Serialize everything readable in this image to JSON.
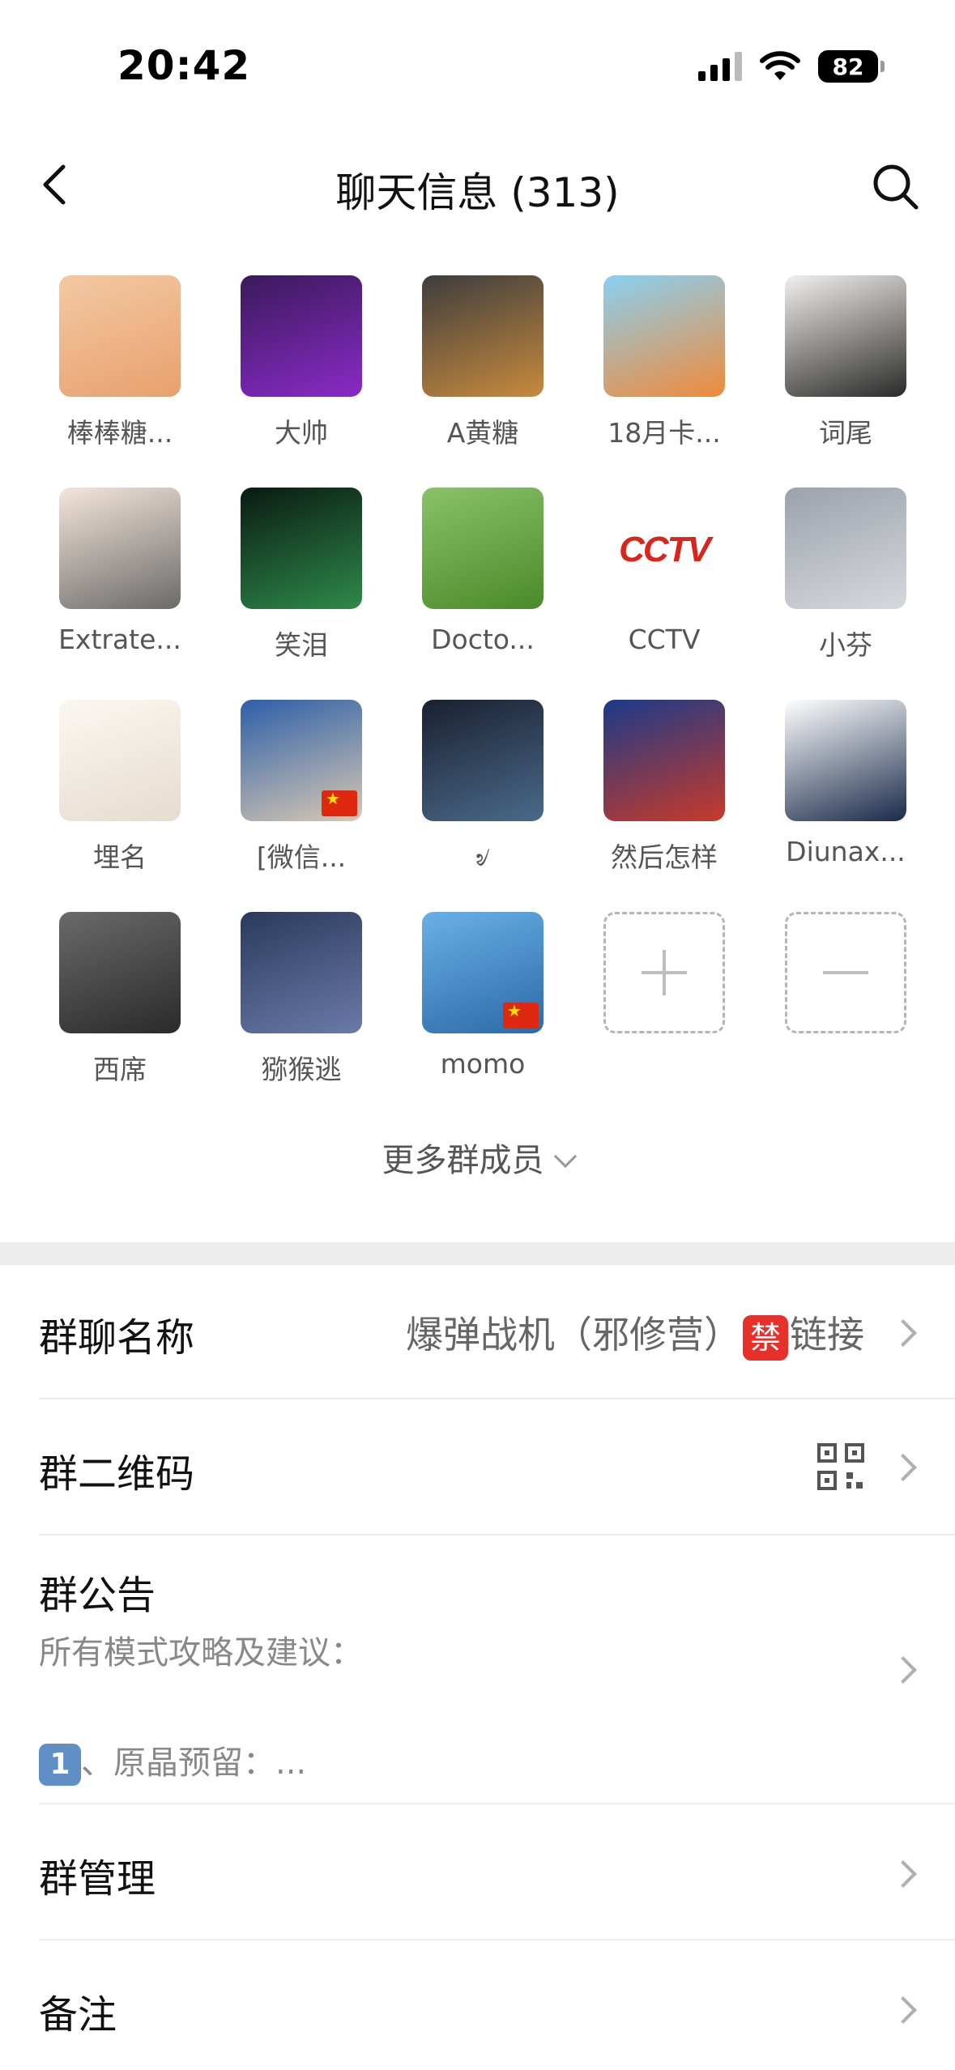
{
  "status_bar": {
    "time": "20:42",
    "battery": "82"
  },
  "nav": {
    "title": "聊天信息 (313)"
  },
  "members": [
    {
      "name": "棒棒糖...",
      "colors": [
        "#f3c9a3",
        "#e8a06e"
      ],
      "flag": false
    },
    {
      "name": "大帅",
      "colors": [
        "#3a1a5a",
        "#8a2ac8"
      ],
      "flag": false
    },
    {
      "name": "A黄糖",
      "colors": [
        "#3d3d3d",
        "#c88a3d"
      ],
      "flag": false
    },
    {
      "name": "18月卡...",
      "colors": [
        "#8ad0f2",
        "#f08a3a"
      ],
      "flag": false
    },
    {
      "name": "词尾",
      "colors": [
        "#f2f0ee",
        "#2a2a2a"
      ],
      "flag": false
    },
    {
      "name": "Extrate...",
      "colors": [
        "#f4e6da",
        "#6a6a6a"
      ],
      "flag": false
    },
    {
      "name": "笑泪",
      "colors": [
        "#0a1a12",
        "#2e8a4a"
      ],
      "flag": false
    },
    {
      "name": "Docto...",
      "colors": [
        "#8ac26a",
        "#4a8a2a"
      ],
      "flag": false
    },
    {
      "name": "CCTV",
      "colors": [
        "#ffffff",
        "#ffffff"
      ],
      "flag": false,
      "logo": "CCTV"
    },
    {
      "name": "小芬",
      "colors": [
        "#9aa2ac",
        "#d8d8dc"
      ],
      "flag": false
    },
    {
      "name": "埋名",
      "colors": [
        "#fbf7f1",
        "#e6dccf"
      ],
      "flag": false
    },
    {
      "name": "[微信...",
      "colors": [
        "#2c5fa8",
        "#d8c8b4"
      ],
      "flag": true
    },
    {
      "name": "৶",
      "colors": [
        "#1a2030",
        "#4a6a8a"
      ],
      "flag": false
    },
    {
      "name": "然后怎样",
      "colors": [
        "#1a3a8a",
        "#c83a2a"
      ],
      "flag": false
    },
    {
      "name": "Diunax...",
      "colors": [
        "#ffffff",
        "#1a2a4a"
      ],
      "flag": false
    },
    {
      "name": "西席",
      "colors": [
        "#6a6a6a",
        "#2a2a2a"
      ],
      "flag": false
    },
    {
      "name": "猕猴逃",
      "colors": [
        "#2a3a5a",
        "#6a7aaa"
      ],
      "flag": false
    },
    {
      "name": "momo",
      "colors": [
        "#6ab0e8",
        "#2a6aa8"
      ],
      "flag": true
    }
  ],
  "more_members": "更多群成员",
  "settings": {
    "group_name_label": "群聊名称",
    "group_name_value_pre": "爆弹战机（邪修营）",
    "group_name_ban": "禁",
    "group_name_value_post": "链接",
    "qr_label": "群二维码",
    "notice_label": "群公告",
    "notice_line1": "所有模式攻略及建议：",
    "notice_keycap": "1",
    "notice_line2": "、原晶预留：...",
    "manage_label": "群管理",
    "remark_label": "备注"
  }
}
